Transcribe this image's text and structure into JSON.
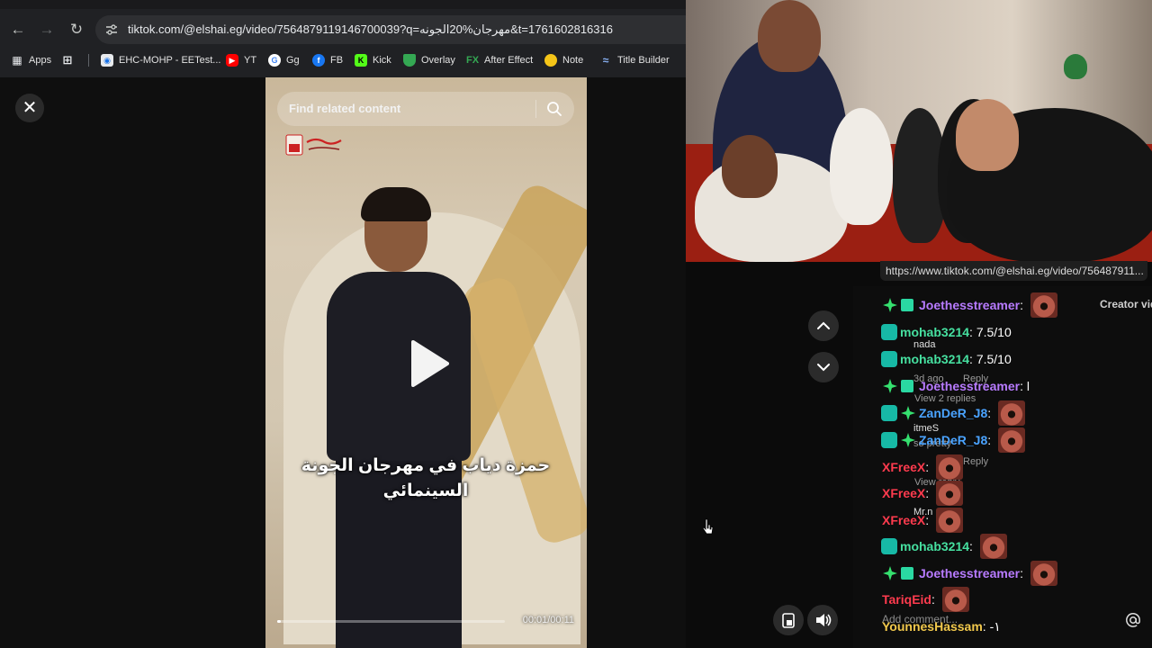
{
  "browser": {
    "url": "tiktok.com/@elshai.eg/video/7564879119146700039?q=مهرجان%20الجونه&t=1761602816316",
    "bookmarks": [
      {
        "label": "Apps",
        "icon": "apps-grid-icon"
      },
      {
        "label": "",
        "icon": "grid-icon"
      },
      {
        "label": "EHC-MOHP - EETest...",
        "icon": "site-icon"
      },
      {
        "label": "YT",
        "icon": "youtube-icon"
      },
      {
        "label": "Gg",
        "icon": "google-icon"
      },
      {
        "label": "FB",
        "icon": "facebook-icon"
      },
      {
        "label": "Kick",
        "icon": "kick-icon"
      },
      {
        "label": "Overlay",
        "icon": "shield-icon"
      },
      {
        "label": "After Effect",
        "icon": "fx-icon"
      },
      {
        "label": "Note",
        "icon": "note-icon"
      },
      {
        "label": "Title Builder",
        "icon": "wave-icon"
      }
    ]
  },
  "viewer": {
    "search_placeholder": "Find related content",
    "caption_line1": "حمزة دياب في مهرجان الجونة",
    "caption_line2": "السينمائي",
    "time": "00:01/00:11",
    "progress_fraction": 0.0
  },
  "url_tooltip": "https://www.tiktok.com/@elshai.eg/video/756487911...",
  "chat": {
    "creator_label": "Creator vid",
    "messages": [
      {
        "user": "Joethesstreamer",
        "text": "",
        "color": "purple",
        "badges": [
          "spark",
          "gift"
        ],
        "emote": true
      },
      {
        "user": "mohab3214",
        "text": "7.5/10",
        "color": "green",
        "badges": [
          "gg"
        ],
        "emote": false
      },
      {
        "user": "mohab3214",
        "text": "7.5/10",
        "color": "green",
        "badges": [
          "gg"
        ],
        "emote": false
      },
      {
        "user": "Joethesstreamer",
        "text": "l",
        "color": "purple",
        "badges": [
          "spark",
          "gift"
        ],
        "emote": false
      },
      {
        "user": "ZanDeR_J8",
        "text": "",
        "color": "blue",
        "badges": [
          "gg",
          "spark"
        ],
        "emote": true
      },
      {
        "user": "ZanDeR_J8",
        "text": "",
        "color": "blue",
        "badges": [
          "gg",
          "spark"
        ],
        "emote": true
      },
      {
        "user": "XFreeX",
        "text": "",
        "color": "red",
        "badges": [],
        "emote": true
      },
      {
        "user": "XFreeX",
        "text": "",
        "color": "red",
        "badges": [],
        "emote": true
      },
      {
        "user": "XFreeX",
        "text": "",
        "color": "red",
        "badges": [],
        "emote": true
      },
      {
        "user": "mohab3214",
        "text": "",
        "color": "green",
        "badges": [
          "gg"
        ],
        "emote": true
      },
      {
        "user": "Joethesstreamer",
        "text": "",
        "color": "purple",
        "badges": [
          "spark",
          "gift"
        ],
        "emote": true
      },
      {
        "user": "TariqEid",
        "text": "",
        "color": "red",
        "badges": [],
        "emote": true
      },
      {
        "user": "YounnesHassam",
        "text": "-١",
        "color": "yellow",
        "badges": [],
        "emote": false
      }
    ],
    "ghost_texts": {
      "nada": "nada",
      "ago": "3d ago",
      "reply": "Reply",
      "view_replies": "View 2 replies",
      "itmes": "itmeS",
      "so_pretty": "so pretty",
      "reply2": "Reply",
      "view_reply": "View reply",
      "mr": "Mr.n"
    },
    "add_comment_placeholder": "Add comment..."
  }
}
